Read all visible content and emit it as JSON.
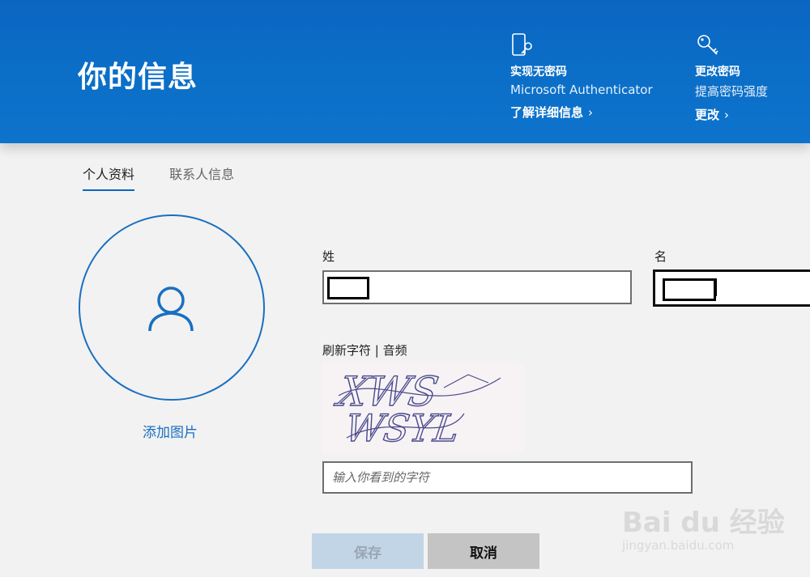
{
  "header": {
    "title": "你的信息",
    "promos": [
      {
        "title": "实现无密码",
        "description": "Microsoft Authenticator",
        "link": "了解详细信息"
      },
      {
        "title": "更改密码",
        "description": "提高密码强度",
        "link": "更改"
      }
    ],
    "chevron": "›"
  },
  "tabs": [
    {
      "label": "个人资料",
      "active": true
    },
    {
      "label": "联系人信息",
      "active": false
    }
  ],
  "avatar": {
    "add_photo_label": "添加图片"
  },
  "form": {
    "last_name_label": "姓",
    "first_name_label": "名",
    "last_name_value": "",
    "first_name_value": "",
    "captcha_refresh": "刷新字符",
    "captcha_separator": " | ",
    "captcha_audio": "音频",
    "captcha_text": "XWS WSYL",
    "captcha_placeholder": "输入你看到的字符"
  },
  "buttons": {
    "save": "保存",
    "cancel": "取消"
  },
  "watermark": {
    "brand": "Bai du 经验",
    "url": "jingyan.baidu.com"
  },
  "colors": {
    "banner": "#0a66c2",
    "accent": "#1a6fc0",
    "save_disabled": "#c2d5e7",
    "cancel": "#c4c4c4"
  }
}
